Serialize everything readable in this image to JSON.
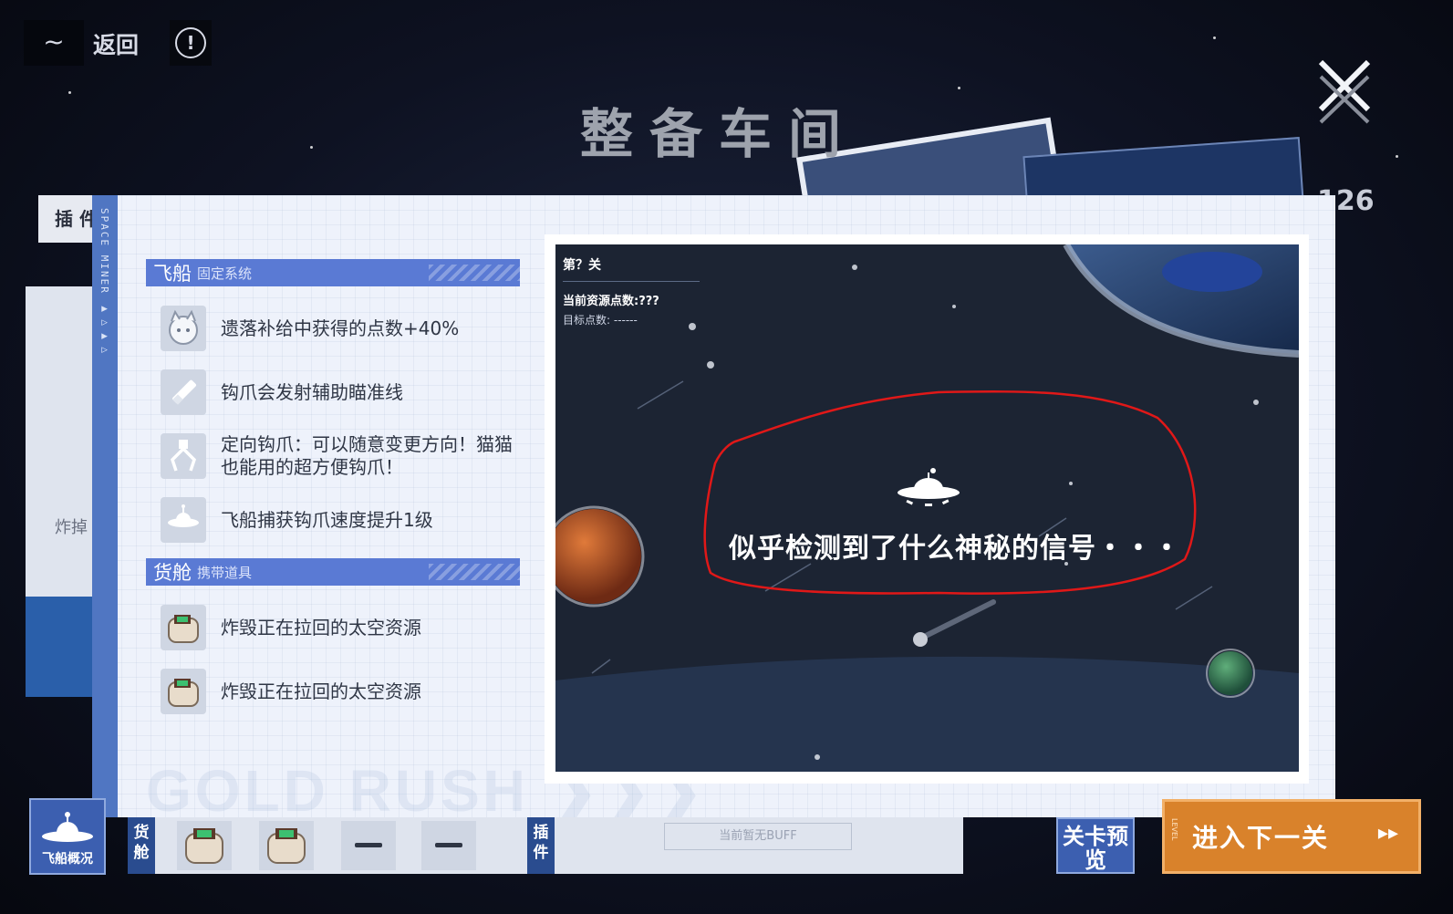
{
  "topbar": {
    "menu_icon": "~",
    "back_label": "返回",
    "info_icon": "!",
    "title": "整备车间",
    "close_icon": "close-icon"
  },
  "background": {
    "left_tab_label": "插 件",
    "left_card_text": "炸掉",
    "right_number": "126"
  },
  "modal": {
    "side_strip_text": "SPACE MINER ▶▷▶▷",
    "watermark": "GOLD RUSH ❯❯❯",
    "ship_section": {
      "title": "飞船",
      "subtitle": "固定系统",
      "items": [
        {
          "icon": "cat-face-icon",
          "text": "遗落补给中获得的点数+40%"
        },
        {
          "icon": "grapple-aim-icon",
          "text": "钩爪会发射辅助瞄准线"
        },
        {
          "icon": "claw-icon",
          "text": "定向钩爪：可以随意变更方向！猫猫也能用的超方便钩爪！"
        },
        {
          "icon": "ufo-icon",
          "text": "飞船捕获钩爪速度提升1级"
        }
      ]
    },
    "cargo_section": {
      "title": "货舱",
      "subtitle": "携带道具",
      "items": [
        {
          "icon": "bomb-icon",
          "text": "炸毁正在拉回的太空资源"
        },
        {
          "icon": "bomb-icon",
          "text": "炸毁正在拉回的太空资源"
        }
      ]
    },
    "preview": {
      "level": "第？关",
      "resource_points": "当前资源点数:???",
      "target_points": "目标点数: ------",
      "signal_text": "似乎检测到了什么神秘的信号・・・"
    }
  },
  "bottombar": {
    "ship_overview_label": "飞船概况",
    "cargo_tag": "货舱",
    "plugin_tag": "插件",
    "buff_text": "当前暂无BUFF",
    "next_preview_label": "关卡预览",
    "next_level_label": "进入下一关",
    "next_level_arrow": "▸▸",
    "level_tag": "LEVEL"
  },
  "colors": {
    "accent_blue": "#5a7ad4",
    "action_orange": "#d9822b",
    "annotation_red": "#e01818"
  }
}
